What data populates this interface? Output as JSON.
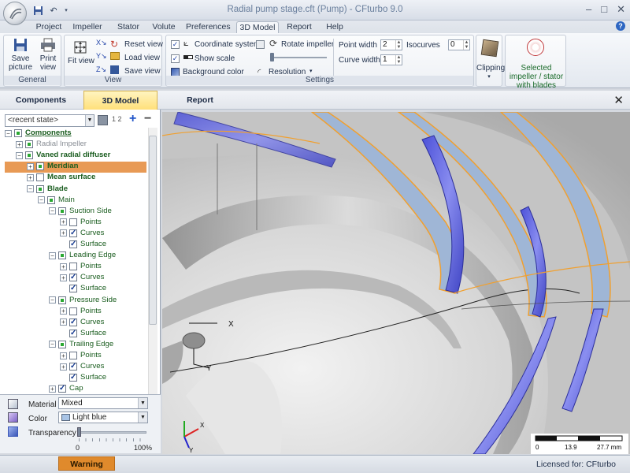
{
  "window": {
    "title": "Radial pump stage.cft (Pump) - CFturbo 9.0",
    "controls": [
      "–",
      "□",
      "✕"
    ]
  },
  "menu_tabs": [
    {
      "label": "Project",
      "active": false
    },
    {
      "label": "Impeller",
      "active": false
    },
    {
      "label": "Stator",
      "active": false
    },
    {
      "label": "Volute",
      "active": false
    },
    {
      "label": "Preferences",
      "active": false
    },
    {
      "label": "3D Model",
      "active": true
    },
    {
      "label": "Report",
      "active": false
    },
    {
      "label": "Help",
      "active": false
    }
  ],
  "ribbon": {
    "general": {
      "label": "General",
      "save_picture": "Save picture",
      "print_view": "Print view"
    },
    "view": {
      "label": "View",
      "fit_view": "Fit view",
      "reset_view": "Reset view",
      "load_view": "Load view",
      "save_view": "Save view"
    },
    "settings": {
      "label": "Settings",
      "coordinate_system": {
        "label": "Coordinate system",
        "checked": true
      },
      "show_scale": {
        "label": "Show scale",
        "checked": true
      },
      "background_color": "Background color",
      "rotate_impeller": {
        "label": "Rotate impeller",
        "checked": false
      },
      "resolution": "Resolution",
      "point_width": {
        "label": "Point width",
        "value": "2"
      },
      "curve_width": {
        "label": "Curve width",
        "value": "1"
      },
      "isocurves": {
        "label": "Isocurves",
        "value": "0"
      }
    },
    "clipping": "Clipping",
    "selected": "Selected impeller / stator with blades"
  },
  "panel_tabs": [
    {
      "label": "Components",
      "active": false
    },
    {
      "label": "3D Model",
      "active": true
    },
    {
      "label": "Report",
      "active": false
    }
  ],
  "state_combo": "<recent state>",
  "tree": [
    {
      "label": "Components",
      "level": 0,
      "expander": "−",
      "check": "part",
      "style": "b"
    },
    {
      "label": "Radial Impeller",
      "level": 1,
      "expander": "+",
      "check": "part",
      "style": "g"
    },
    {
      "label": "Vaned radial diffuser",
      "level": 1,
      "expander": "−",
      "check": "part",
      "style": "b"
    },
    {
      "label": "Meridian",
      "level": 2,
      "expander": "+",
      "check": "part",
      "style": "b",
      "selected": true
    },
    {
      "label": "Mean surface",
      "level": 2,
      "expander": "+",
      "check": "none",
      "style": "b"
    },
    {
      "label": "Blade",
      "level": 2,
      "expander": "−",
      "check": "part",
      "style": "b"
    },
    {
      "label": "Main",
      "level": 3,
      "expander": "−",
      "check": "part",
      "style": "grn"
    },
    {
      "label": "Suction Side",
      "level": 4,
      "expander": "−",
      "check": "part",
      "style": "grn"
    },
    {
      "label": "Points",
      "level": 5,
      "expander": "+",
      "check": "none",
      "style": "grn"
    },
    {
      "label": "Curves",
      "level": 5,
      "expander": "+",
      "check": "checked",
      "style": "grn"
    },
    {
      "label": "Surface",
      "level": 5,
      "expander": "",
      "check": "checked",
      "style": "grn"
    },
    {
      "label": "Leading Edge",
      "level": 4,
      "expander": "−",
      "check": "part",
      "style": "grn"
    },
    {
      "label": "Points",
      "level": 5,
      "expander": "+",
      "check": "none",
      "style": "grn"
    },
    {
      "label": "Curves",
      "level": 5,
      "expander": "+",
      "check": "checked",
      "style": "grn"
    },
    {
      "label": "Surface",
      "level": 5,
      "expander": "",
      "check": "checked",
      "style": "grn"
    },
    {
      "label": "Pressure Side",
      "level": 4,
      "expander": "−",
      "check": "part",
      "style": "grn"
    },
    {
      "label": "Points",
      "level": 5,
      "expander": "+",
      "check": "none",
      "style": "grn"
    },
    {
      "label": "Curves",
      "level": 5,
      "expander": "+",
      "check": "checked",
      "style": "grn"
    },
    {
      "label": "Surface",
      "level": 5,
      "expander": "",
      "check": "checked",
      "style": "grn"
    },
    {
      "label": "Trailing Edge",
      "level": 4,
      "expander": "−",
      "check": "part",
      "style": "grn"
    },
    {
      "label": "Points",
      "level": 5,
      "expander": "+",
      "check": "none",
      "style": "grn"
    },
    {
      "label": "Curves",
      "level": 5,
      "expander": "+",
      "check": "checked",
      "style": "grn"
    },
    {
      "label": "Surface",
      "level": 5,
      "expander": "",
      "check": "checked",
      "style": "grn"
    },
    {
      "label": "Cap",
      "level": 4,
      "expander": "+",
      "check": "checked",
      "style": "grn"
    }
  ],
  "properties": {
    "material": {
      "label": "Material",
      "value": "Mixed"
    },
    "color": {
      "label": "Color",
      "value": "Light blue",
      "swatch": "#a9c4e6"
    },
    "transparency": {
      "label": "Transparency",
      "min": "0",
      "max": "100%",
      "level": 0
    }
  },
  "viewport": {
    "axis_x": "X",
    "axis_y": "Y",
    "scale": {
      "ticks": [
        "0",
        "13.9",
        "27.7 mm"
      ]
    },
    "blade_color": "#5f64e0",
    "surface_color": "#9fb6d6",
    "edge_color": "#f0a030"
  },
  "status": {
    "warning": "Warning",
    "license": "Licensed for: CFturbo"
  }
}
